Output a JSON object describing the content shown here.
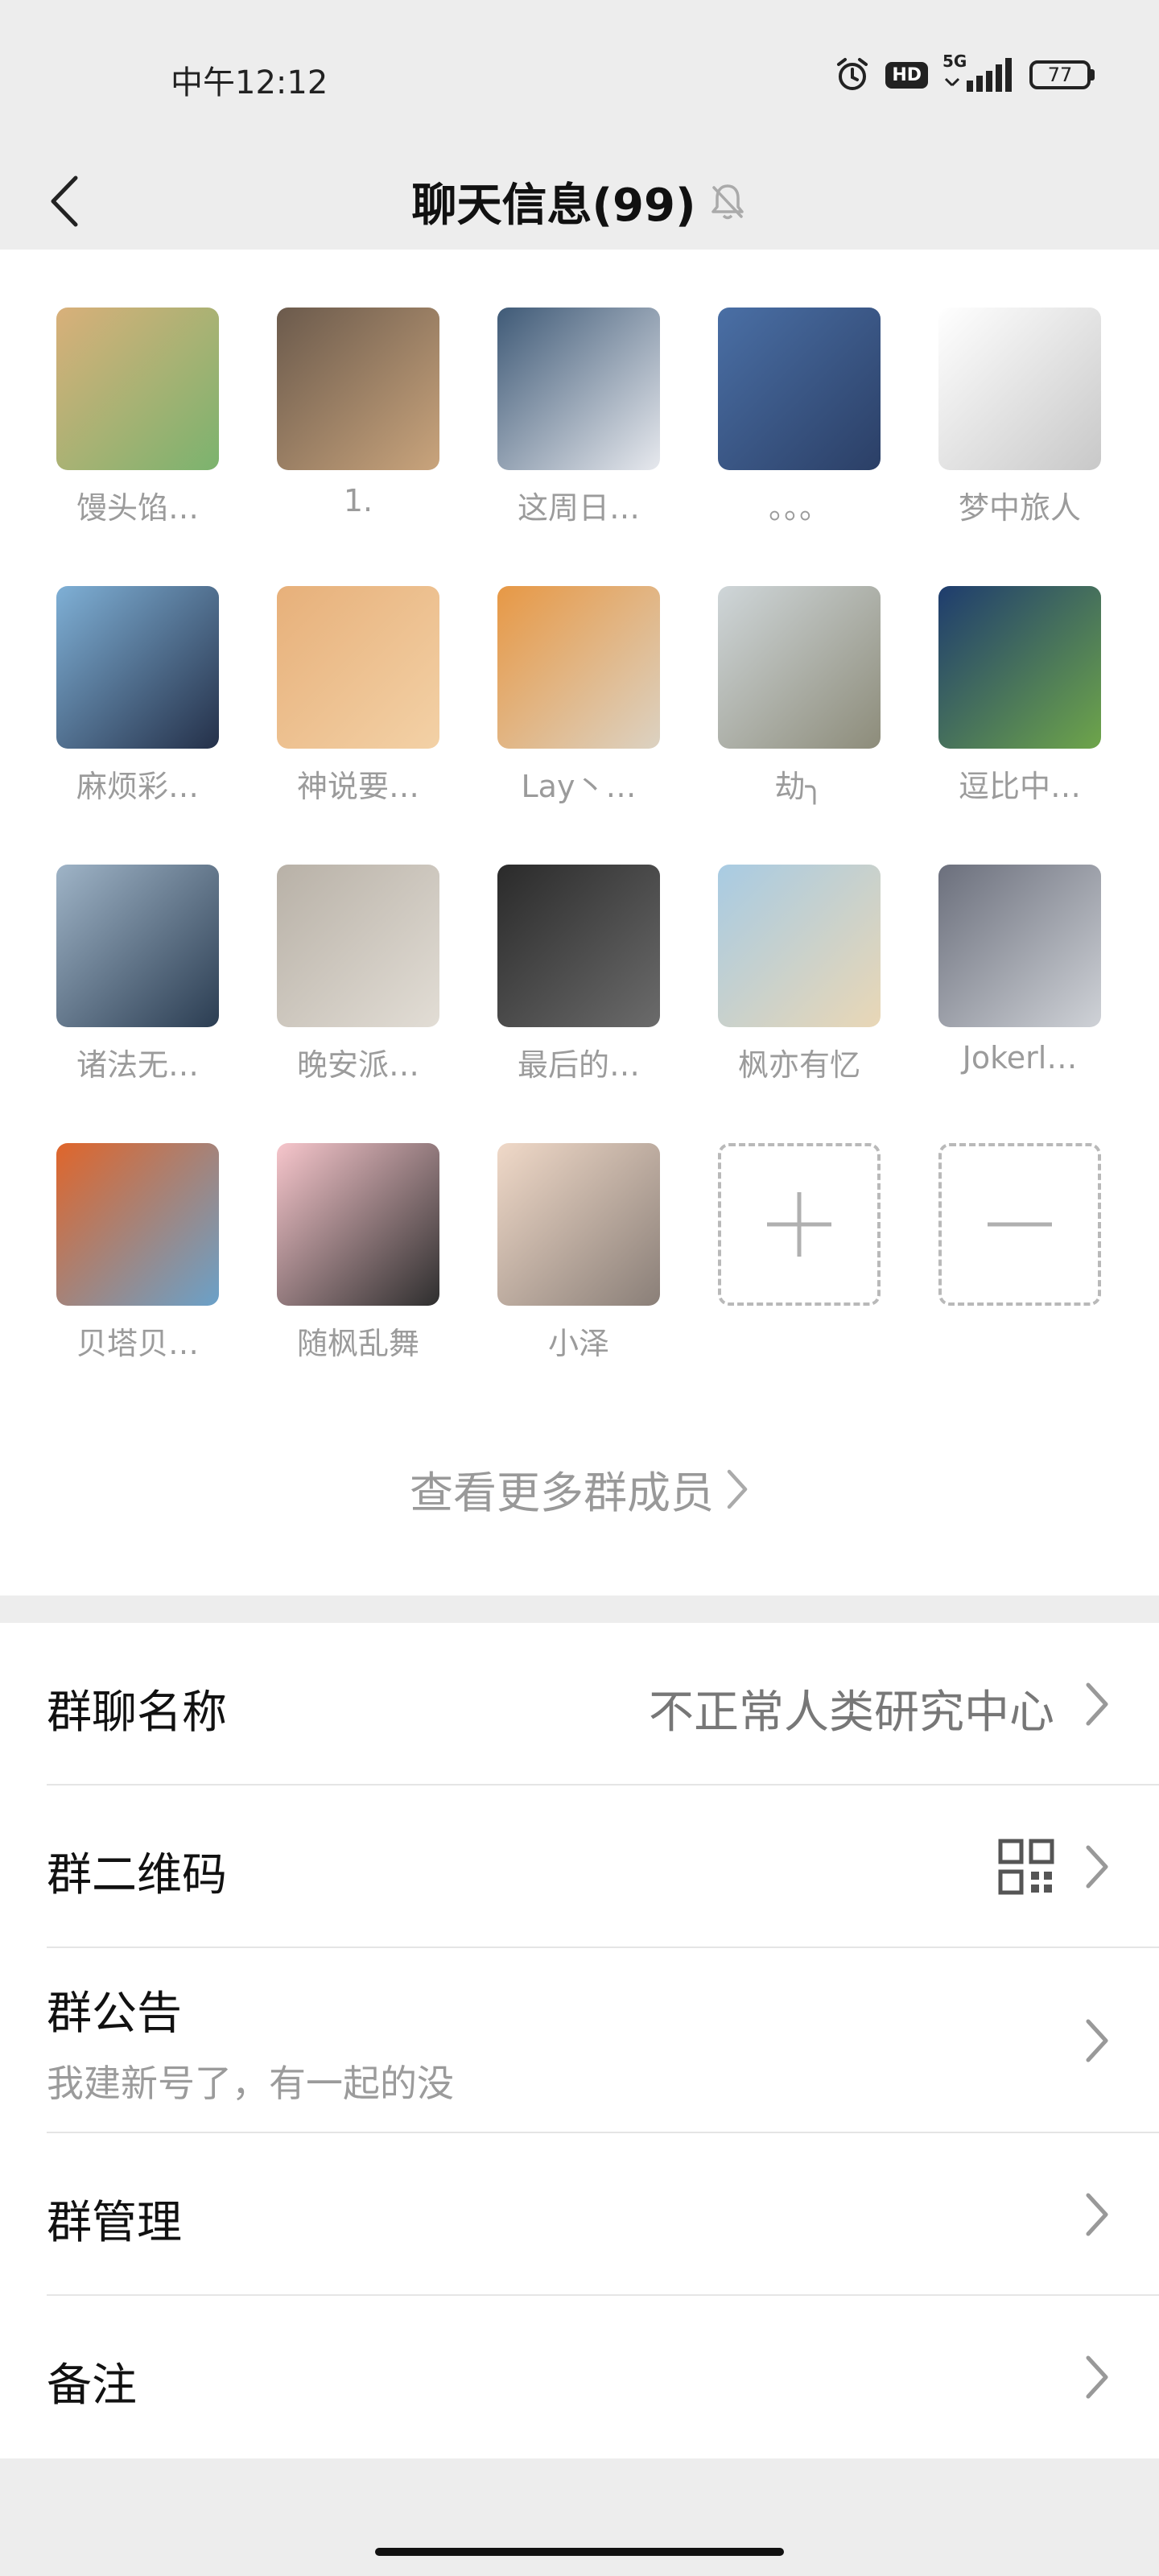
{
  "status_bar": {
    "time": "中午12:12",
    "hd": "HD",
    "network": "5G",
    "battery": "77"
  },
  "header": {
    "title": "聊天信息(99)"
  },
  "members": [
    {
      "name": "馒头馅…",
      "avatar_colors": [
        "#d9b07a",
        "#7bb36e"
      ]
    },
    {
      "name": "1.",
      "avatar_colors": [
        "#6b5a4c",
        "#c9a47c"
      ]
    },
    {
      "name": "这周日…",
      "avatar_colors": [
        "#3f5a77",
        "#e7e9ee"
      ]
    },
    {
      "name": "。。。",
      "avatar_colors": [
        "#4a6fa5",
        "#2b3f66"
      ]
    },
    {
      "name": "梦中旅人",
      "avatar_colors": [
        "#ffffff",
        "#c8c8c8"
      ]
    },
    {
      "name": "麻烦彩…",
      "avatar_colors": [
        "#7fb0d6",
        "#243049"
      ]
    },
    {
      "name": "神说要…",
      "avatar_colors": [
        "#e7b07a",
        "#f3d1a6"
      ]
    },
    {
      "name": "Lay丶…",
      "avatar_colors": [
        "#e79845",
        "#dcd2c2"
      ]
    },
    {
      "name": "劫╮",
      "avatar_colors": [
        "#cfd6d9",
        "#8d8c7a"
      ]
    },
    {
      "name": "逗比中…",
      "avatar_colors": [
        "#1e3c6e",
        "#6ea54a"
      ]
    },
    {
      "name": "诸法无…",
      "avatar_colors": [
        "#9fb4c7",
        "#2b3d52"
      ]
    },
    {
      "name": "晚安派…",
      "avatar_colors": [
        "#b8b1a7",
        "#e2ddd5"
      ]
    },
    {
      "name": "最后的…",
      "avatar_colors": [
        "#2a2a2a",
        "#6b6b6b"
      ]
    },
    {
      "name": "枫亦有忆",
      "avatar_colors": [
        "#a8cbe3",
        "#e9d7b6"
      ]
    },
    {
      "name": "Jokerl…",
      "avatar_colors": [
        "#6b6f7c",
        "#cfd2d7"
      ]
    },
    {
      "name": "贝塔贝…",
      "avatar_colors": [
        "#e0652a",
        "#6aa1c9"
      ]
    },
    {
      "name": "随枫乱舞",
      "avatar_colors": [
        "#f7c6cc",
        "#2e2e2e"
      ]
    },
    {
      "name": "小泽",
      "avatar_colors": [
        "#f0d9c8",
        "#8a7f78"
      ]
    }
  ],
  "actions": {
    "add": "+",
    "remove": "−"
  },
  "more_members": "查看更多群成员",
  "settings": {
    "group_name_label": "群聊名称",
    "group_name_value": "不正常人类研究中心",
    "qr_label": "群二维码",
    "notice_label": "群公告",
    "notice_text": "我建新号了，有一起的没",
    "manage_label": "群管理",
    "remark_label": "备注"
  },
  "colors": {
    "background": "#ededed",
    "panel": "#ffffff",
    "muted_text": "#9b9b9b"
  }
}
